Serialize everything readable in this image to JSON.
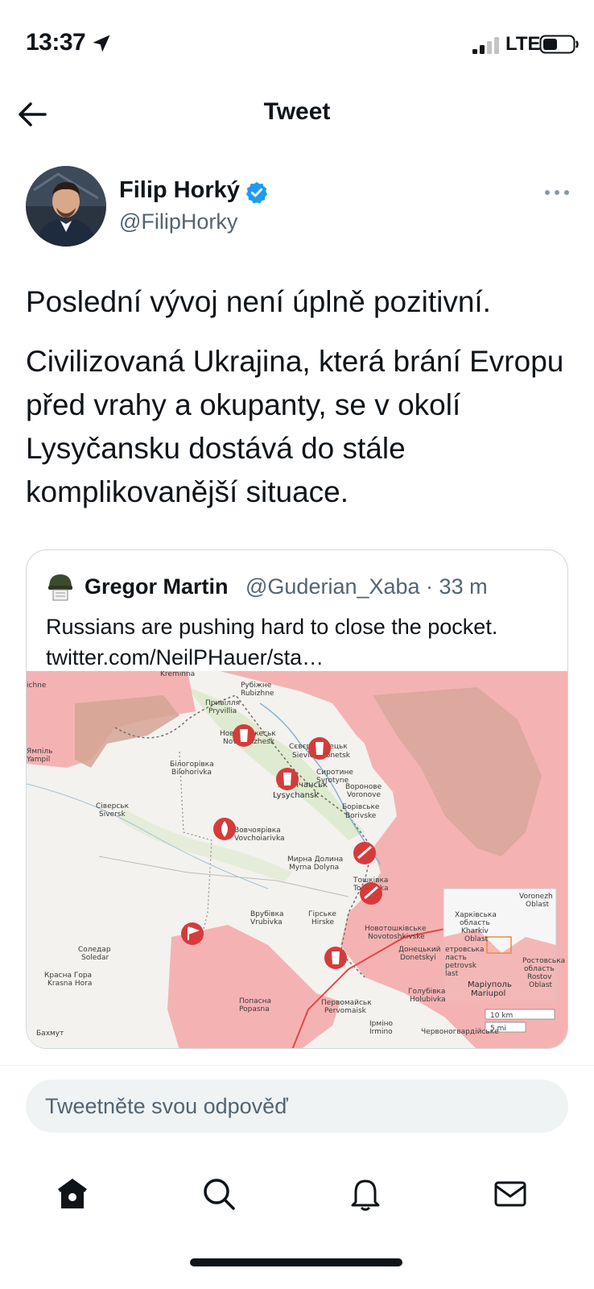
{
  "status_bar": {
    "time": "13:37",
    "network": "LTE"
  },
  "header": {
    "title": "Tweet"
  },
  "tweet": {
    "author_name": "Filip Horký",
    "author_handle": "@FilipHorky",
    "paragraphs": [
      "Poslední vývoj není úplně pozitivní.",
      "Civilizovaná Ukrajina, která brání Evropu před vrahy a okupanty, se v okolí Lysyčansku dostává do stále komplikovanější situace."
    ]
  },
  "quoted_tweet": {
    "author_name": "Gregor Martin",
    "meta": "@Guderian_Xaba · 33 m",
    "text": "Russians are pushing hard to close the pocket.",
    "link": "twitter.com/NeilPHauer/sta…",
    "map": {
      "places": [
        "Kreminna",
        "Рубіжне",
        "Rubizhne",
        "Привілля",
        "Pryvillia",
        "Новодружеськ",
        "Novodruzhesk",
        "Сєвєродонецьк",
        "Sievierodonetsk",
        "Сиротине",
        "Syrotyne",
        "Воронове",
        "Voronove",
        "Лисичанськ",
        "Lysychansk",
        "Білогорівка",
        "Bilohorivka",
        "Ямпіль",
        "Yampil",
        "Сіверськ",
        "Siversk",
        "Борівське",
        "Borivske",
        "Вовчоярівка",
        "Vovchoiarivka",
        "Мирна Долина",
        "Myrna Dolyna",
        "Тошківка",
        "Toshkivka",
        "Врубівка",
        "Vrubivka",
        "Гірське",
        "Hirske",
        "Новотошківське",
        "Novotoshkivske",
        "Донецький",
        "Donetskyi",
        "Соледар",
        "Soledar",
        "Красна Гора",
        "Krasna Hora",
        "Попасна",
        "Popasna",
        "Первомайськ",
        "Pervomaisk",
        "Голубівка",
        "Holubivka",
        "Ірміно",
        "Irmino",
        "Бахмут",
        "Червоногвардійське",
        "ichne"
      ],
      "inset": {
        "labels": [
          "Voronezh",
          "Oblast",
          "Харківська",
          "область",
          "Kharkiv",
          "Oblast",
          "Ростовська",
          "область",
          "Rostov",
          "Oblast",
          "Маріуполь",
          "Mariupol",
          "етровська",
          "ласть",
          "petrovsk",
          "last"
        ]
      },
      "scale": [
        "10 km",
        "5 mi"
      ]
    }
  },
  "reply": {
    "placeholder": "Tweetněte svou odpověď"
  },
  "tabs": [
    "home",
    "search",
    "notifications",
    "messages"
  ],
  "colors": {
    "accent": "#1d9bf0",
    "occupied": "#f4a3a3",
    "text": "#0f1419",
    "secondary": "#536471"
  }
}
